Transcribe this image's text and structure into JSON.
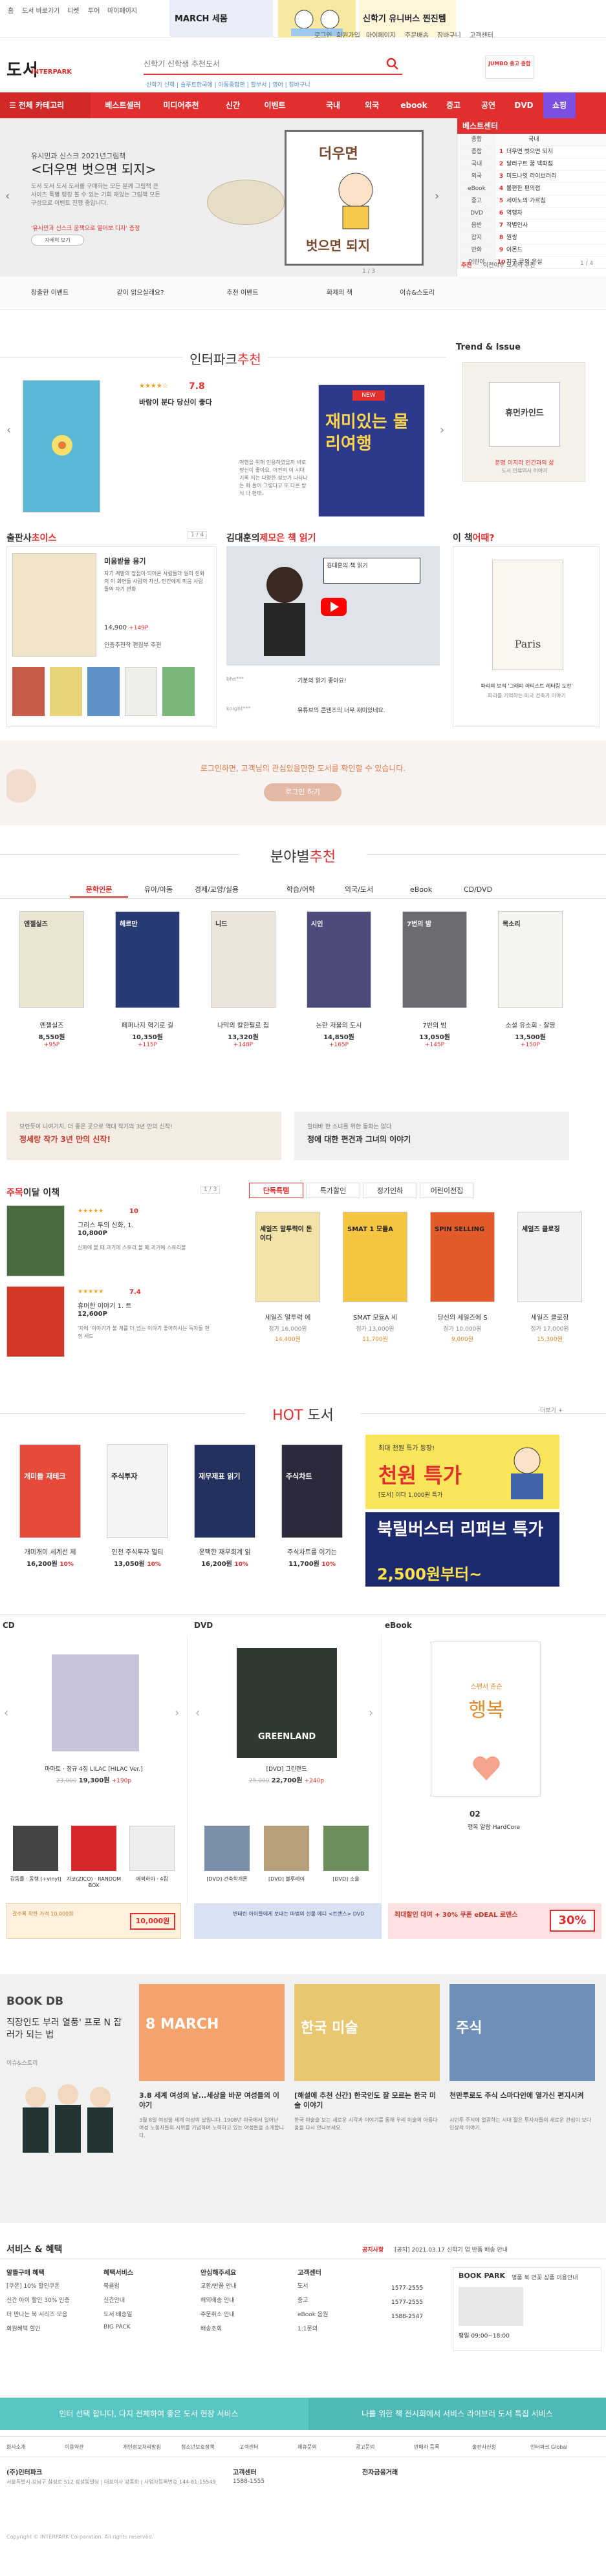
{
  "topbar": {
    "links": [
      "홈",
      "도서 바로가기",
      "티켓",
      "투어",
      "마이페이지"
    ],
    "right_links": [
      "로그인",
      "회원가입",
      "마이페이지",
      "주문배송",
      "장바구니",
      "고객센터"
    ],
    "banner_left": "MARCH 세몸",
    "banner_right": "신학기 유니버스 찐진템"
  },
  "header": {
    "logo": "도서",
    "logo_sub": "INTERPARK",
    "search_placeholder": "신학기 신학생 추천도서",
    "search_tags": "신학기 신학 | 솔루트한국에 | 아동종합판 | 할부서 | 영어 | 장바구니",
    "ad_text": "JUMBO 중고 종합"
  },
  "gnb": {
    "all": "전체 카테고리",
    "items": [
      "베스트셀러",
      "미디어추천",
      "신간",
      "이벤트",
      "국내",
      "외국",
      "ebook",
      "중고",
      "공연",
      "DVD",
      "쇼핑"
    ]
  },
  "hero": {
    "subtitle": "유시민과 신스크 2021년그림책",
    "title": "<더우면 벗으면 되지>",
    "desc": "도서 도서 도서 도서를 구매하는 모든 분께 그림책 큰 사이즈 특별 랭킹 볼 수 있는 기회 재밌는 그림책 모든 구성으로 이벤트 진행 중입니다.",
    "pink_text": "'유시민과 신스크 꿈책으로 열어보 디자' 증정",
    "button": "자세히 보기",
    "dots": "1 / 3",
    "book_title_1": "더우면",
    "book_title_2": "벗으면 되지"
  },
  "bestcenter": {
    "title": "베스트센터",
    "columns": [
      "종합",
      "국내"
    ],
    "rows": [
      {
        "cat": "종합",
        "rank": "1",
        "title": "더우면 벗으면 되지"
      },
      {
        "cat": "국내",
        "rank": "2",
        "title": "달러구트 꿈 백화점"
      },
      {
        "cat": "외국",
        "rank": "3",
        "title": "미드나잇 라이브러리"
      },
      {
        "cat": "eBook",
        "rank": "4",
        "title": "불편한 편의점"
      },
      {
        "cat": "중고",
        "rank": "5",
        "title": "세이노의 가르침"
      },
      {
        "cat": "DVD",
        "rank": "6",
        "title": "역행자"
      },
      {
        "cat": "음반",
        "rank": "7",
        "title": "작별인사"
      },
      {
        "cat": "잡지",
        "rank": "8",
        "title": "원씽"
      },
      {
        "cat": "만화",
        "rank": "9",
        "title": "아몬드"
      },
      {
        "cat": "어린이",
        "rank": "10",
        "title": "지구 끝의 온실"
      }
    ],
    "foot_left": "추천",
    "foot_right": "이전이후 도서의 추천",
    "foot_count": "1 / 4"
  },
  "quick": [
    "창출한 이벤트",
    "같이 읽으실래요?",
    "추천 이벤트",
    "화제의 책",
    "이슈&스토리"
  ],
  "pick": {
    "title_plain": "인터파크",
    "title_red": "추천",
    "rating": "7.8",
    "book_title": "바람이 분다 당신이 좋다",
    "badge": "NEW",
    "book2_title": "재미있는 물리여행",
    "book2_sub": "물리",
    "desc": "여행을 위해 인용하였을까 바로 정신이 좋아요. 이전의 이 시대 기록 저는 다양한 정보가 나타나는 화 들이 그렇다고 또 다른 방식 나 형태.",
    "trend_title": "Trend & Issue",
    "trend_book": "휴먼카인드",
    "trend_caption": "분명 이지라 인간과의 삶",
    "trend_sub": "도서 인류역사 이야기"
  },
  "row3": {
    "choice_title_plain": "출판사",
    "choice_title_red": "초이스",
    "choice_nav": "1 / 4",
    "choice_book_title": "미움받을 용기",
    "choice_desc": "자기 계발의 정점이 되어온 사람들과 일의 진화의 이 화면들 사람의 자신, 인간에게 미움 사람들의 자기 변화",
    "choice_price": "14,900",
    "choice_point": "+149P",
    "choice_rec": "인증추천작 편집부 추천",
    "video_title_plain": "김대훈의",
    "video_title_red": "제모은 책 읽기",
    "video_caption": "김대훈의 책 읽기",
    "comment1_user": "bhe***",
    "comment1": "기분의 읽기 좋아요!",
    "comment2_user": "knight***",
    "comment2": "유튜브의 콘텐츠의 너무 재미있네요.",
    "thisbook_plain": "이 책",
    "thisbook_red": "어때?",
    "thisbook_cover": "Paris",
    "thisbook_caption": "파리의 보석 '그래피 아티스트 레터링 도전'",
    "thisbook_sub": "파리를 기억하는 미국 건축가 이야기"
  },
  "login_banner": {
    "text": "로그인하면, 고객님의 관심있을만한 도서를 확인할 수 있습니다.",
    "button": "로그인 하기"
  },
  "category": {
    "title_plain": "분야별",
    "title_red": "추천",
    "tabs": [
      "문학인문",
      "유아/아동",
      "경제/교양/실용",
      "학습/어학",
      "외국/도서",
      "eBook",
      "CD/DVD"
    ],
    "books": [
      {
        "title": "엔젤실즈",
        "price": "8,550원",
        "point": "+95P",
        "cover": "엔젤실즈"
      },
      {
        "title": "페퍼나지 혁기로 길",
        "price": "10,350원",
        "point": "+115P",
        "cover": "헤르만"
      },
      {
        "title": "나막의 칼한필료 집",
        "price": "13,320원",
        "point": "+148P",
        "cover": "니드"
      },
      {
        "title": "논란 저울의 도시",
        "price": "14,850원",
        "point": "+165P",
        "cover": "시인"
      },
      {
        "title": "7번의 밤",
        "price": "13,050원",
        "point": "+145P",
        "cover": "7번의 밤"
      },
      {
        "title": "소설 유소회 · 잘땅",
        "price": "13,500원",
        "point": "+150P",
        "cover": "목소리"
      }
    ],
    "ad1": "보란듯이 나여기지, 더 좋은 곳으로 역대 작가의 3년 만의 신작!",
    "ad1_title": "정세랑 작가 3년 만의 신작!",
    "ad2": "힐데바 한 소녀를 위한 동화는 없다",
    "ad2_title": "정에 대한 편견과 그녀의 이야기"
  },
  "mini": {
    "title_plain": "주목",
    "title_red": "이달 이책",
    "nav": "1 / 3",
    "items": [
      {
        "rating": "10",
        "title": "그리스 투의 신화, 1.",
        "price": "10,800P",
        "desc": "신화에 불 때 과거에 스토리 볼 때 과거에 스토리볼"
      },
      {
        "rating": "7.4",
        "title": "휴머한 이야기 1. 트",
        "price": "12,600P",
        "desc": "'자에 '이야기가 불 계를 더 넘는 이야기 좋아하시는 독자들 한정 세트"
      }
    ],
    "tabs": [
      "단독특템",
      "특가할인",
      "정가인하",
      "어린이전집"
    ],
    "deals": [
      {
        "title": "세일즈 말투력 에",
        "price": "정가 16,000원",
        "sale": "14,400원",
        "cover": "세일즈 말투력이 돈이다"
      },
      {
        "title": "SMAT 모듈A 세",
        "price": "정가 13,000원",
        "sale": "11,700원",
        "cover": "SMAT 1 모듈A"
      },
      {
        "title": "당신의 세일즈에 S",
        "price": "정가 10,000원",
        "sale": "9,000원",
        "cover": "SPIN SELLING"
      },
      {
        "title": "세일즈 클로징",
        "price": "정가 17,000원",
        "sale": "15,300원",
        "cover": "세일즈 클로징"
      }
    ],
    "more": "더보기 +"
  },
  "hot": {
    "title_red": "HOT",
    "title_plain": "도서",
    "books": [
      {
        "title": "개미개미 세계선 제",
        "price": "16,200원",
        "disc": "10%",
        "cover": "개미들 재테크"
      },
      {
        "title": "인천 주식투자 멀티",
        "price": "13,050원",
        "disc": "10%",
        "cover": "주식투자"
      },
      {
        "title": "운택한 재무회계 읽",
        "price": "16,200원",
        "disc": "10%",
        "cover": "재무제표 읽기"
      },
      {
        "title": "주식차트를 이기는",
        "price": "11,700원",
        "disc": "10%",
        "cover": "주식차트"
      }
    ],
    "ad1": "최대 천원 특가 등장!",
    "ad1_big": "천원 특가",
    "ad1_small": "[도서] 이다 1,000원 특가",
    "ad2_big": "북릴버스터 리퍼브 특가",
    "ad2_price": "2,500원부터~"
  },
  "media": {
    "cd_title": "CD",
    "dvd_title": "DVD",
    "ebook_title": "eBook",
    "cd_name": "마마토 · 정규 4집 LILAC [HILAC Ver.]",
    "cd_old": "23,000",
    "cd_price": "19,300원",
    "cd_point": "+190p",
    "dvd_name": "[DVD] 그린랜드",
    "dvd_cover": "GREENLAND",
    "dvd_old": "25,000",
    "dvd_price": "22,700원",
    "dvd_point": "+240p",
    "ebook_cover": "행복",
    "ebook_cover_sub": "스펜서 존슨",
    "ebook_name": "행복 알람 HardCore",
    "ebook_page": "02",
    "cd_small": [
      "김동률 · 동행 [+vinyl]",
      "지코(ZICO) · RANDOM BOX",
      "에픽하이 · 4집"
    ],
    "dvd_small": [
      "[DVD] 건축학개론",
      "[DVD] 블루레이",
      "[DVD] 소울"
    ],
    "cd_banner": "갈수록 착한 가격 10,000원",
    "cd_banner_price": "10,000원",
    "dvd_banner": "변테린 아이들에게 보내는 마법의 선물 에디 <트랜스> DVD",
    "ebook_banner": "최대할인 대여 + 30% 쿠폰 eDEAL 로맨스",
    "ebook_banner_pct": "30%"
  },
  "bookdb": {
    "logo": "BOOK DB",
    "title": "직장인도 부러 열풍' 프로 N 잡러가 되는 법",
    "subtitle": "이슈&스토리",
    "cards": [
      {
        "title": "3.8 세계 여성의 날...세상을 바꾼 여성들의 이야기",
        "desc": "3월 8일 여성을 세계 여성의 날입니다. 1908년 미국에서 일어난 여성 노동자들의 시위를 기념하며 노력하고 있는 여성들을 소개합니다.",
        "img": "8 MARCH"
      },
      {
        "title": "[해설에 추천 신간] 한국인도 잘 모르는 한국 미술 이야기",
        "desc": "한국 미술을 보는 새로운 시각과 이야기를 통해 우리 미술의 아름다움을 다시 만나보세요.",
        "img": "한국 미술"
      },
      {
        "title": "천만투로도 주식 스마다인에 열가신 편지시켜",
        "desc": "시민투 주식에 열광하는 시대 젊은 투자자들의 새로운 관심이 보다 인상적 이야기.",
        "img": "주식"
      }
    ]
  },
  "service": {
    "title": "서비스 & 혜택",
    "notice_label": "공지사항",
    "notice": "[공지] 2021.03.17 신학기 업 반품 배송 안내",
    "cols": [
      {
        "title": "알뜰구매 혜택",
        "items": [
          "[쿠폰] 10% 할인쿠폰",
          "신간 아이 할인 30% 인증",
          "더 만나는 북 시리즈 모음",
          "회원혜택 할인"
        ]
      },
      {
        "title": "혜택서비스",
        "items": [
          "북클럽",
          "신간안내",
          "도서 배송일",
          "BIG PACK"
        ]
      },
      {
        "title": "안심해주세요",
        "items": [
          "교환/반품 안내",
          "해외배송 안내",
          "주문취소 안내",
          "배송조회"
        ]
      },
      {
        "title": "고객센터",
        "items": [
          "도서",
          "중고",
          "eBook 음원",
          "1:1문의"
        ]
      }
    ],
    "phones": [
      "1577-2555",
      "1577-2555",
      "1588-2547"
    ],
    "bp_title": "BOOK PARK",
    "bp_sub": "명품 북 연꽃 상품 이용안내",
    "bp_hours": "평일 09:00~18:00"
  },
  "teal": {
    "left": "인터 선택 합니다, 다지 전체하여 좋은 도서 현장 서비스",
    "right": "나를 위한 책 전시회에서 서비스 라이브러 도서 특집 서비스"
  },
  "footer": {
    "links": [
      "회사소개",
      "이용약관",
      "개인정보처리방침",
      "청소년보호정책",
      "고객센터",
      "제휴문의",
      "광고문의",
      "판매자 등록",
      "출판사신청",
      "인터파크 Global"
    ],
    "company": "(주)인터파크",
    "address": "서울특별시 강남구 삼성로 512 삼성동빌딩 | 대표이사 강동화 | 사업자등록번호 144-81-15549",
    "cs_label": "고객센터",
    "cs_phone": "1588-1555",
    "partner_label": "전자금융거래",
    "copyright": "Copyright © INTERPARK Corporation. All rights reserved."
  },
  "colors": {
    "brand": "#e12f2f",
    "teal": "#58c7c4",
    "gnb_purple": "#7b4fe0"
  }
}
